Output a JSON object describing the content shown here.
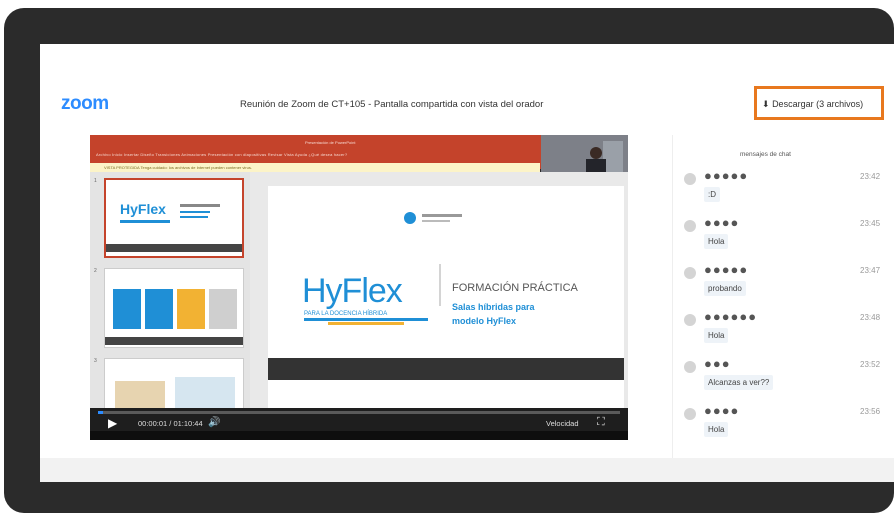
{
  "window": {
    "logo": "zoom",
    "title": "Reunión de Zoom de CT+105 - Pantalla compartida con vista del orador",
    "download_label": "Descargar (3 archivos)"
  },
  "video": {
    "ppt_window_title": "Presentación de PowerPoint",
    "ppt_tabs": "Archivo   Inicio   Insertar   Diseño   Transiciones   Animaciones   Presentación con diapositivas   Revisar   Vista   Ayuda   ¿Qué desea hacer?",
    "ppt_message": "VISTA PROTEGIDA   Tenga cuidado: los archivos de Internet pueden contener virus.",
    "slide": {
      "brand": "HyFlex",
      "brand_tagline": "PARA LA DOCENCIA HÍBRIDA",
      "heading": "FORMACIÓN PRÁCTICA",
      "subheading_1": "Salas híbridas para",
      "subheading_2": "modelo HyFlex"
    },
    "thumb_numbers": [
      "1",
      "2",
      "3"
    ],
    "time": "00:00:01 / 01:10:44",
    "speed_label": "Velocidad",
    "progress": 0.01
  },
  "chat": {
    "title": "mensajes de chat",
    "messages": [
      {
        "name": "●●●●●",
        "time": "23:42",
        "text": ":D"
      },
      {
        "name": "●●●●",
        "time": "23:45",
        "text": "Hola"
      },
      {
        "name": "●●●●●",
        "time": "23:47",
        "text": "probando"
      },
      {
        "name": "●●●●●●",
        "time": "23:48",
        "text": "Hola"
      },
      {
        "name": "●●●",
        "time": "23:52",
        "text": "Alcanzas a ver??"
      },
      {
        "name": "●●●●",
        "time": "23:56",
        "text": "Hola"
      }
    ]
  },
  "colors": {
    "zoom_blue": "#2d8cff",
    "highlight_orange": "#e8781e",
    "ppt_red": "#c4432b",
    "hyflex_blue": "#1f8fd6"
  }
}
